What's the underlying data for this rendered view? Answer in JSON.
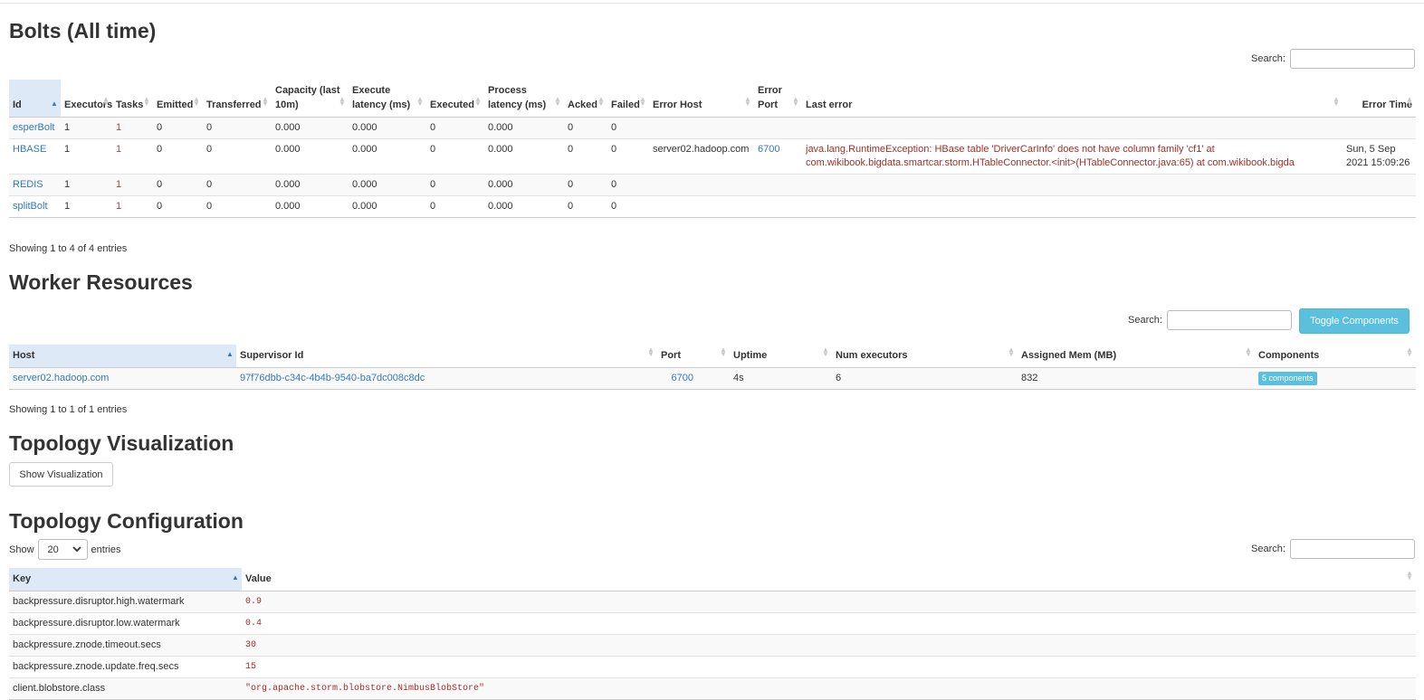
{
  "bolts": {
    "title": "Bolts (All time)",
    "search_label": "Search:",
    "columns": [
      "Id",
      "Executors",
      "Tasks",
      "Emitted",
      "Transferred",
      "Capacity (last 10m)",
      "Execute latency (ms)",
      "Executed",
      "Process latency (ms)",
      "Acked",
      "Failed",
      "Error Host",
      "Error Port",
      "Last error",
      "Error Time"
    ],
    "rows": [
      {
        "id": "esperBolt",
        "executors": "1",
        "tasks": "1",
        "emitted": "0",
        "transferred": "0",
        "capacity": "0.000",
        "execute_latency": "0.000",
        "executed": "0",
        "process_latency": "0.000",
        "acked": "0",
        "failed": "0",
        "error_host": "",
        "error_port": "",
        "last_error": "",
        "error_time": ""
      },
      {
        "id": "HBASE",
        "executors": "1",
        "tasks": "1",
        "emitted": "0",
        "transferred": "0",
        "capacity": "0.000",
        "execute_latency": "0.000",
        "executed": "0",
        "process_latency": "0.000",
        "acked": "0",
        "failed": "0",
        "error_host": "server02.hadoop.com",
        "error_port": "6700",
        "last_error": "java.lang.RuntimeException: HBase table 'DriverCarInfo' does not have column family 'cf1' at com.wikibook.bigdata.smartcar.storm.HTableConnector.<init>(HTableConnector.java:65) at com.wikibook.bigda",
        "error_time": "Sun, 5 Sep 2021 15:09:26"
      },
      {
        "id": "REDIS",
        "executors": "1",
        "tasks": "1",
        "emitted": "0",
        "transferred": "0",
        "capacity": "0.000",
        "execute_latency": "0.000",
        "executed": "0",
        "process_latency": "0.000",
        "acked": "0",
        "failed": "0",
        "error_host": "",
        "error_port": "",
        "last_error": "",
        "error_time": ""
      },
      {
        "id": "splitBolt",
        "executors": "1",
        "tasks": "1",
        "emitted": "0",
        "transferred": "0",
        "capacity": "0.000",
        "execute_latency": "0.000",
        "executed": "0",
        "process_latency": "0.000",
        "acked": "0",
        "failed": "0",
        "error_host": "",
        "error_port": "",
        "last_error": "",
        "error_time": ""
      }
    ],
    "info": "Showing 1 to 4 of 4 entries"
  },
  "workers": {
    "title": "Worker Resources",
    "search_label": "Search:",
    "toggle_label": "Toggle Components",
    "columns": [
      "Host",
      "Supervisor Id",
      "Port",
      "Uptime",
      "Num executors",
      "Assigned Mem (MB)",
      "Components"
    ],
    "rows": [
      {
        "host": "server02.hadoop.com",
        "supervisor_id": "97f76dbb-c34c-4b4b-9540-ba7dc008c8dc",
        "port": "6700",
        "uptime": "4s",
        "num_executors": "6",
        "assigned_mem": "832",
        "components": "5 components"
      }
    ],
    "info": "Showing 1 to 1 of 1 entries"
  },
  "visualization": {
    "title": "Topology Visualization",
    "button_label": "Show Visualization"
  },
  "configuration": {
    "title": "Topology Configuration",
    "show_label": "Show",
    "page_size": "20",
    "entries_label": "entries",
    "search_label": "Search:",
    "columns": [
      "Key",
      "Value"
    ],
    "rows": [
      {
        "key": "backpressure.disruptor.high.watermark",
        "value": "0.9"
      },
      {
        "key": "backpressure.disruptor.low.watermark",
        "value": "0.4"
      },
      {
        "key": "backpressure.znode.timeout.secs",
        "value": "30"
      },
      {
        "key": "backpressure.znode.update.freq.secs",
        "value": "15"
      },
      {
        "key": "client.blobstore.class",
        "value": "\"org.apache.storm.blobstore.NimbusBlobStore\""
      }
    ]
  }
}
